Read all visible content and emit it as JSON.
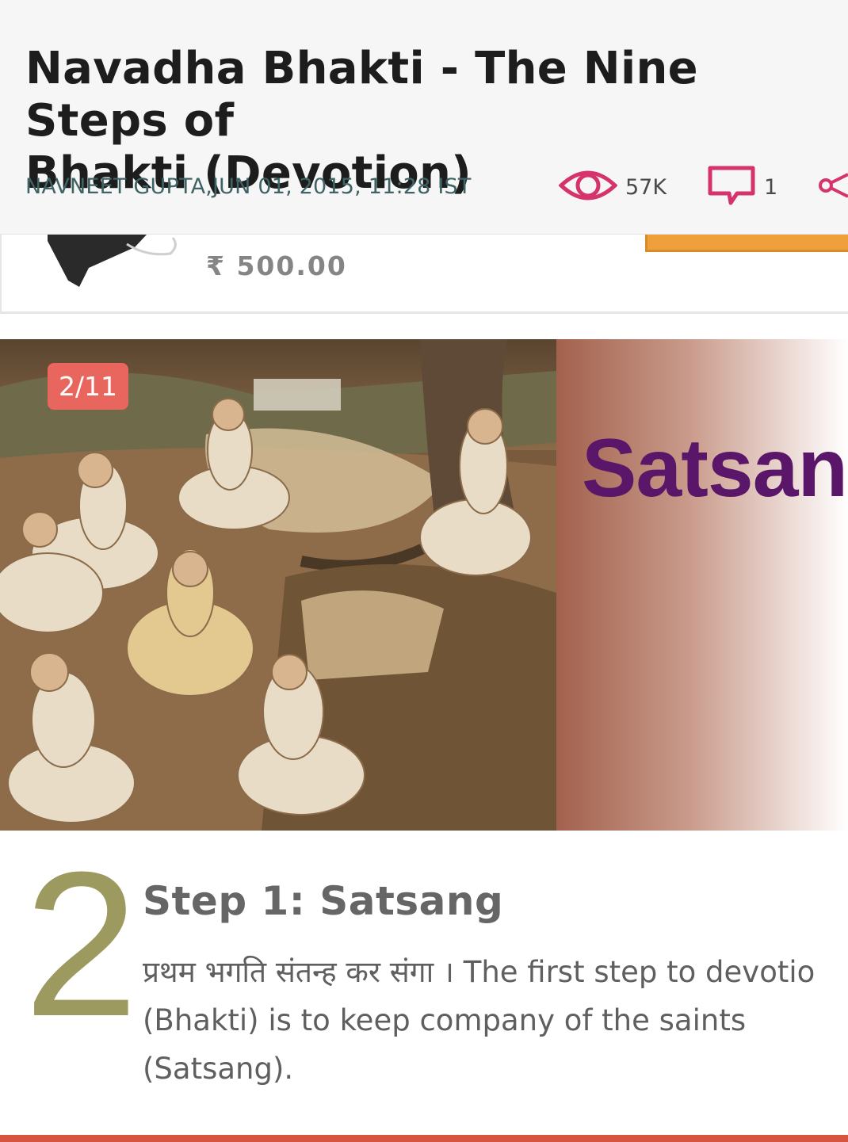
{
  "article": {
    "title_line1": "Navadha Bhakti - The Nine Steps of",
    "title_line2": "Bhakti (Devotion)",
    "byline": "NAVNEET GUPTA,JUN 01, 2015, 11:28 IST",
    "views": "57K",
    "comments": "1"
  },
  "product": {
    "price": "₹ 500.00"
  },
  "gallery": {
    "counter": "2/11",
    "image_caption": "Satsang"
  },
  "step": {
    "number": "2",
    "title": "Step 1: Satsang",
    "body_line1": "प्रथम भगति संतन्ह कर संगा । The first step to devotio",
    "body_line2": "(Bhakti) is to keep company of the saints",
    "body_line3": "(Satsang)."
  },
  "colors": {
    "accent": "#d6336c",
    "counter_bg": "#e8665d",
    "number_olive": "#9c9a5e",
    "satsang_purple": "#5a1668",
    "buy_orange": "#f0a03a"
  },
  "icons": [
    "eye-icon",
    "comment-icon",
    "share-icon"
  ]
}
